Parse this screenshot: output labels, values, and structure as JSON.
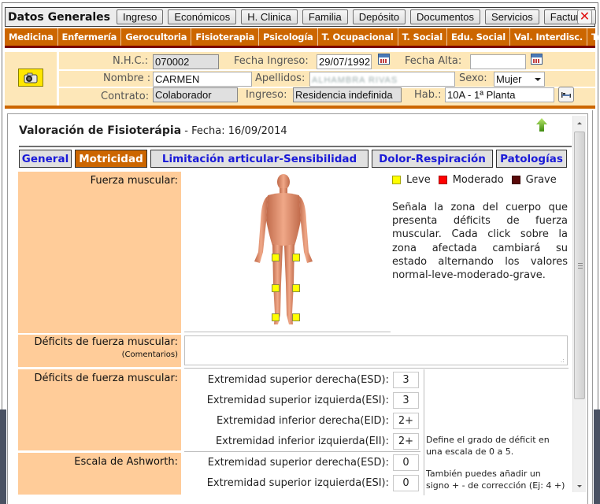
{
  "topbar": {
    "title": "Datos Generales",
    "buttons": [
      "Ingreso",
      "Económicos",
      "H. Clinica",
      "Familia",
      "Depósito",
      "Documentos",
      "Servicios",
      "Facturas"
    ],
    "close_label": "✕"
  },
  "nav": {
    "items": [
      "Medicina",
      "Enfermería",
      "Gerocultoria",
      "Fisioterapia",
      "Psicología",
      "T. Ocupacional",
      "T. Social",
      "Edu. Social",
      "Val. Interdisc.",
      "Test"
    ]
  },
  "patient": {
    "nhc_label": "N.H.C.:",
    "nhc_value": "070002",
    "fecha_ingreso_label": "Fecha Ingreso:",
    "fecha_ingreso_value": "29/07/1992",
    "fecha_alta_label": "Fecha Alta:",
    "fecha_alta_value": "",
    "nombre_label": "Nombre :",
    "nombre_value": "CARMEN",
    "apellidos_label": "Apellidos:",
    "apellidos_value": "ALHAMBRA RIVAS",
    "sexo_label": "Sexo:",
    "sexo_value": "Mujer",
    "contrato_label": "Contrato:",
    "contrato_value": "Colaborador",
    "ingreso_label": "Ingreso:",
    "ingreso_value": "Residencia indefinida",
    "hab_label": "Hab.:",
    "hab_value": "10A - 1ª Planta"
  },
  "panel": {
    "title": "Valoración de Fisioterápia",
    "date_label": " - Fecha: 16/09/2014",
    "tabs": [
      "General",
      "Motricidad",
      "Limitación articular-Sensibilidad",
      "Dolor-Respiración",
      "Patologías"
    ],
    "active_tab": "Motricidad"
  },
  "fuerza": {
    "label": "Fuerza muscular:",
    "legend": [
      {
        "label": "Leve",
        "color": "#ffff00"
      },
      {
        "label": "Moderado",
        "color": "#ff0000"
      },
      {
        "label": "Grave",
        "color": "#5a0a0a"
      }
    ],
    "help": "Señala la zona del cuerpo que presenta déficits de fuerza muscular. Cada click sobre la zona afectada cambiará su estado alternando los valores normal-leve-moderado-grave.",
    "zones": [
      {
        "name": "muslo-derecho",
        "state": "leve"
      },
      {
        "name": "muslo-izquierdo",
        "state": "leve"
      },
      {
        "name": "rodilla-derecha",
        "state": "leve"
      },
      {
        "name": "rodilla-izquierda",
        "state": "leve"
      },
      {
        "name": "tobillo-derecho",
        "state": "leve"
      },
      {
        "name": "tobillo-izquierdo",
        "state": "leve"
      }
    ]
  },
  "comentarios": {
    "label": "Déficits de fuerza muscular:",
    "sublabel": "(Comentarios)",
    "value": ""
  },
  "deficits": {
    "label": "Déficits de fuerza muscular:",
    "rows": [
      {
        "label": "Extremidad superior derecha(ESD):",
        "value": "3"
      },
      {
        "label": "Extremidad superior izquierda(ESI):",
        "value": "3"
      },
      {
        "label": "Extremidad inferior derecha(EID):",
        "value": "2+"
      },
      {
        "label": "Extremidad inferior izquierda(EII):",
        "value": "2+"
      }
    ]
  },
  "ashworth": {
    "label": "Escala de Ashworth:",
    "rows": [
      {
        "label": "Extremidad superior derecha(ESD):",
        "value": "0"
      },
      {
        "label": "Extremidad superior izquierda(ESI):",
        "value": "0"
      }
    ]
  },
  "notes": {
    "line1": "Define el grado de déficit en",
    "line2": "una escala de 0 a 5.",
    "line3": "También puedes añadir un",
    "line4": "signo + - de corrección (Ej: 4 +)"
  }
}
